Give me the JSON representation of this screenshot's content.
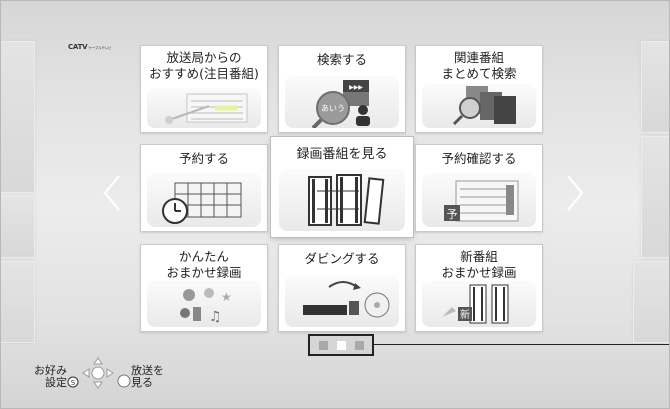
{
  "brand": {
    "name": "CATV",
    "sub": "ケーブルテレビ"
  },
  "tiles": [
    {
      "label_line1": "放送局からの",
      "label_line2": "おすすめ(注目番組)"
    },
    {
      "label_line1": "検索する",
      "label_line2": ""
    },
    {
      "label_line1": "関連番組",
      "label_line2": "まとめて検索"
    },
    {
      "label_line1": "予約する",
      "label_line2": ""
    },
    {
      "label_line1": "録画番組を見る",
      "label_line2": ""
    },
    {
      "label_line1": "予約確認する",
      "label_line2": ""
    },
    {
      "label_line1": "かんたん",
      "label_line2": "おまかせ録画"
    },
    {
      "label_line1": "ダビングする",
      "label_line2": ""
    },
    {
      "label_line1": "新番組",
      "label_line2": "おまかせ録画"
    }
  ],
  "selected_tile": "録画番組を見る",
  "pager": {
    "pages": 3,
    "current": 2
  },
  "icon_glyphs": {
    "yoyaku": "予",
    "shin": "新",
    "aiu": "あいう"
  },
  "hints": {
    "favorites_line1": "お好み",
    "favorites_line2": "設定",
    "favorites_key": "S",
    "watch_line1": "放送を",
    "watch_line2": "見る"
  },
  "icons": [
    "chevron-left-icon",
    "chevron-right-icon",
    "remote-dpad-icon",
    "enter-circle-icon"
  ]
}
